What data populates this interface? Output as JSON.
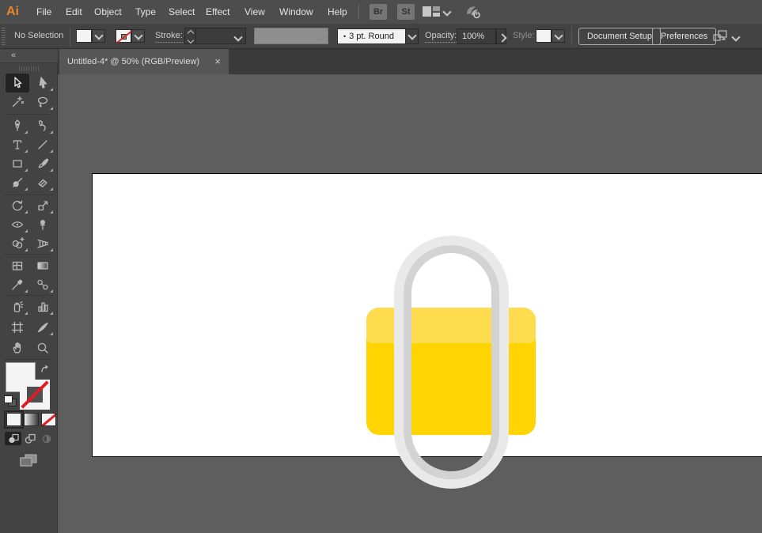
{
  "app": {
    "logo": "Ai"
  },
  "menubar": {
    "items": [
      "File",
      "Edit",
      "Object",
      "Type",
      "Select",
      "Effect",
      "View",
      "Window",
      "Help"
    ],
    "br_label": "Br",
    "st_label": "St",
    "icons": [
      "workspace-switcher-icon",
      "chevron-down-icon",
      "sync-settings-icon"
    ]
  },
  "controlbar": {
    "selection_status": "No Selection",
    "stroke_label": "Stroke:",
    "brush_bullet": "•",
    "brush_value": "3 pt. Round",
    "opacity_label": "Opacity:",
    "opacity_value": "100%",
    "style_label": "Style:",
    "document_setup_label": "Document Setup",
    "preferences_label": "Preferences",
    "icons": [
      "fill-swatch",
      "stroke-none-swatch",
      "arrange-artboards-icon"
    ]
  },
  "tabbar": {
    "tabs": [
      {
        "title": "Untitled-4* @ 50% (RGB/Preview)",
        "close": "×"
      }
    ]
  },
  "toolbar": {
    "collapse_icon": "«",
    "tools": [
      "selection-tool",
      "direct-selection-tool",
      "magic-wand-tool",
      "lasso-tool",
      "pen-tool",
      "curvature-tool",
      "type-tool",
      "line-segment-tool",
      "rectangle-tool",
      "paintbrush-tool",
      "shaper-tool",
      "eraser-tool",
      "rotate-tool",
      "scale-tool",
      "width-tool",
      "puppet-warp-tool",
      "shape-builder-tool",
      "perspective-grid-tool",
      "mesh-tool",
      "gradient-tool",
      "eyedropper-tool",
      "blend-tool",
      "symbol-sprayer-tool",
      "column-graph-tool",
      "artboard-tool",
      "slice-tool",
      "hand-tool",
      "zoom-tool"
    ],
    "selected_tool": "selection-tool",
    "controls": [
      "fill-swatch",
      "swap-fill-stroke-icon",
      "stroke-swatch-none",
      "default-fill-stroke-icon",
      "color-button",
      "gradient-button",
      "none-button",
      "draw-normal-mode",
      "draw-behind-mode",
      "draw-inside-mode",
      "change-screen-mode-icon"
    ]
  },
  "canvas": {
    "artwork": {
      "shapes": [
        "padlock-body",
        "padlock-body-highlight",
        "padlock-shackle-ring"
      ]
    }
  },
  "colors": {
    "accent_yellow": "#FFD400",
    "accent_yellow_light": "#FFDC4D",
    "ring_gray": "#E9E9E9",
    "ring_rim_gray": "#D3D3D3",
    "stroke_none_red": "#E01B22",
    "logo_orange": "#E8882A",
    "ui_bar": "#4D4D4D",
    "ui_panel": "#434343",
    "pasteboard": "#5E5E5E",
    "artboard": "#FFFFFF"
  }
}
